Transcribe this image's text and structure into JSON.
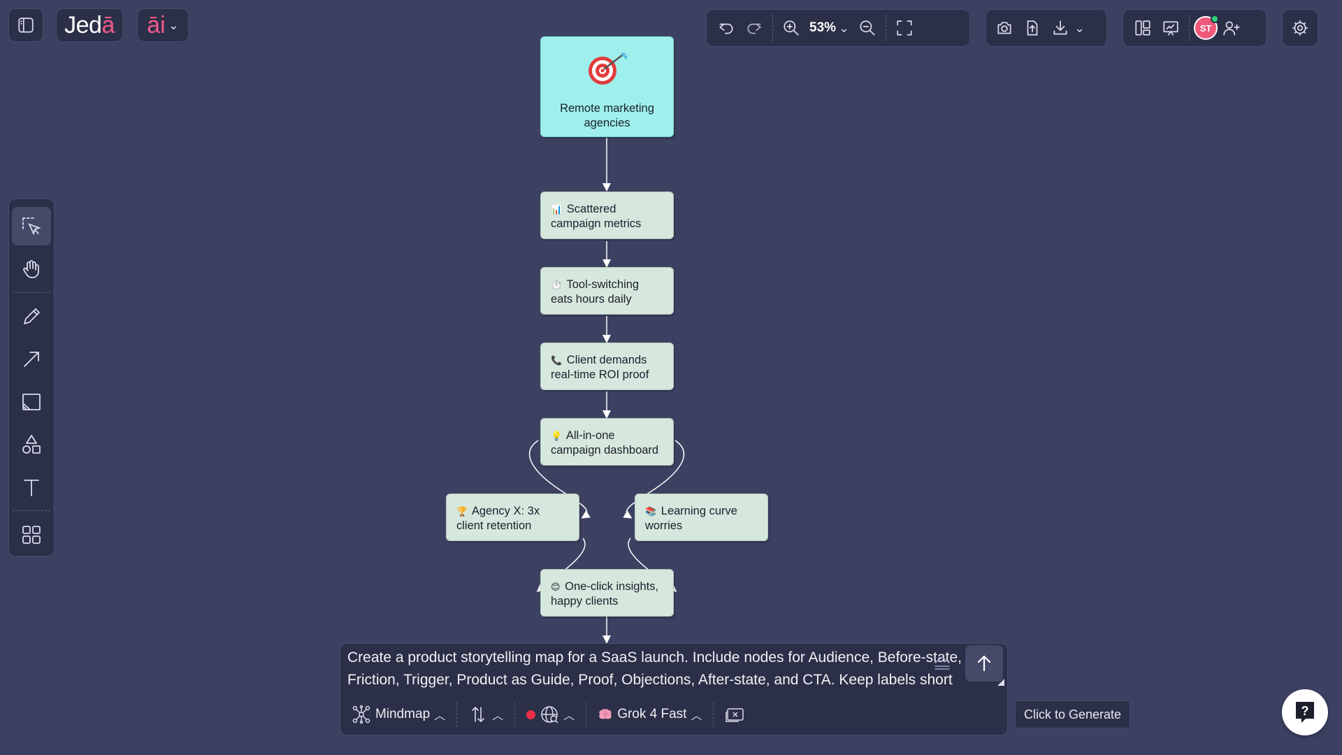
{
  "app": {
    "logo_text_main": "Jed",
    "logo_text_accent": "ā",
    "ai_label": "āi"
  },
  "toolbar": {
    "zoom_value": "53%"
  },
  "user": {
    "initials": "ST"
  },
  "mindmap": {
    "root": {
      "label": "Remote marketing agencies",
      "icon": "target-dart-icon"
    },
    "nodes": [
      {
        "emoji": "📊",
        "label": "Scattered campaign metrics"
      },
      {
        "emoji": "⏱️",
        "label": "Tool-switching eats hours daily"
      },
      {
        "emoji": "📞",
        "label": "Client demands real-time ROI proof"
      },
      {
        "emoji": "💡",
        "label": "All-in-one campaign dashboard"
      },
      {
        "emoji": "🏆",
        "label": "Agency X: 3x client retention"
      },
      {
        "emoji": "📚",
        "label": "Learning curve worries"
      },
      {
        "emoji": "😊",
        "label": "One-click insights, happy clients"
      }
    ]
  },
  "prompt": {
    "text": "Create a product storytelling map for a SaaS launch. Include nodes for Audience, Before-state, Friction, Trigger, Product as Guide, Proof, Objections, After-state, and CTA. Keep labels short",
    "mode_label": "Mindmap",
    "model_label": "Grok 4 Fast"
  },
  "tooltip": {
    "text": "Click to Generate"
  },
  "colors": {
    "background": "#3c4162",
    "panel": "#2b2f47",
    "node": "#d6e7de",
    "root_node": "#9ff0ec",
    "accent": "#f05a8a"
  }
}
